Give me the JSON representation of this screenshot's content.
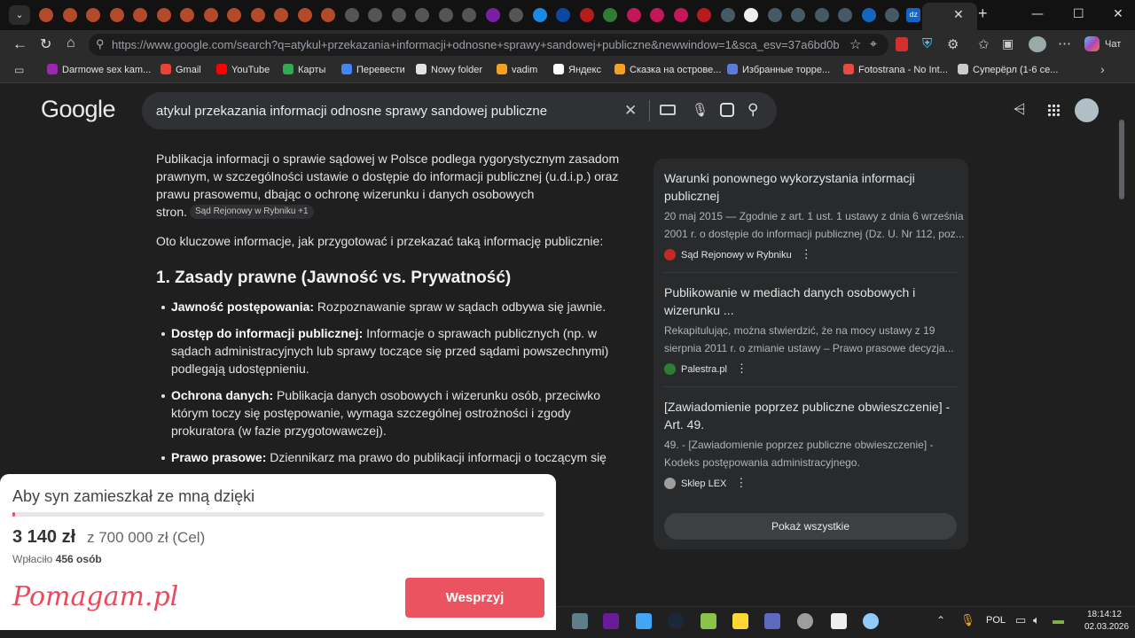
{
  "browser": {
    "url": "https://www.google.com/search?q=atykul+przekazania+informacji+odnosne+sprawy+sandowej+publiczne&newwindow=1&sca_esv=37a6bd0bd2466e07&s...",
    "profile_label": "Чат",
    "tabs_fav_labels": [
      "dz",
      "dz"
    ]
  },
  "bookmarks": [
    {
      "label": "Darmowe sex kam...",
      "color": "#9c27b0"
    },
    {
      "label": "Gmail",
      "color": "#ea4335"
    },
    {
      "label": "YouTube",
      "color": "#ff0000"
    },
    {
      "label": "Карты",
      "color": "#34a853"
    },
    {
      "label": "Перевести",
      "color": "#4285f4"
    },
    {
      "label": "Nowy folder",
      "color": "#e3e3e3"
    },
    {
      "label": "vadim",
      "color": "#f4a023"
    },
    {
      "label": "Яндекс",
      "color": "#ffffff"
    },
    {
      "label": "Сказка на острове...",
      "color": "#f4a023"
    },
    {
      "label": "Избранные торре...",
      "color": "#5b7bd5"
    },
    {
      "label": "Fotostrana - No Int...",
      "color": "#e94a3f"
    },
    {
      "label": "Суперёрл (1-6 се...",
      "color": "#cccccc"
    }
  ],
  "google": {
    "logo": "Google",
    "query": "atykul przekazania informacji odnosne sprawy sandowej publiczne"
  },
  "answer": {
    "intro_lines": [
      "Publikacja informacji o sprawie sądowej w Polsce podlega rygorystycznym zasadom",
      "prawnym, w szczególności ustawie o dostępie do informacji publicznej (u.d.i.p.) oraz",
      "prawu prasowemu, dbając o ochronę wizerunku i danych osobowych",
      "stron."
    ],
    "intro_chip": "Sąd Rejonowy w Rybniku +1",
    "lead": "Oto kluczowe informacje, jak przygotować i przekazać taką informację publicznie:",
    "heading": "1. Zasady prawne (Jawność vs. Prywatność)",
    "bullets": [
      {
        "bold": "Jawność postępowania:",
        "lines": [
          " Rozpoznawanie spraw w sądach odbywa się jawnie."
        ]
      },
      {
        "bold": "Dostęp do informacji publicznej:",
        "lines": [
          " Informacje o sprawach publicznych (np. w",
          "sądach administracyjnych lub sprawy toczące się przed sądami powszechnymi)",
          "podlegają udostępnieniu."
        ]
      },
      {
        "bold": "Ochrona danych:",
        "lines": [
          " Publikacja danych osobowych i wizerunku osób, przeciwko",
          "którym toczy się postępowanie, wymaga szczególnej ostrożności i zgody",
          "prokuratora (w fazie przygotowawczej)."
        ]
      },
      {
        "bold": "Prawo prasowe:",
        "lines": [
          " Dziennikarz ma prawo do publikacji informacji o toczącym się"
        ]
      }
    ]
  },
  "sources": [
    {
      "title": [
        "Warunki ponownego wykorzystania informacji",
        "publicznej"
      ],
      "desc": [
        "20 maj 2015 — Zgodnie z art. 1 ust. 1 ustawy z dnia 6 września",
        "2001 r. o dostępie do informacji publicznej (Dz. U. Nr 112, poz..."
      ],
      "site": "Sąd Rejonowy w Rybniku",
      "color": "#c62828"
    },
    {
      "title": [
        "Publikowanie w mediach danych osobowych i",
        "wizerunku ..."
      ],
      "desc": [
        "Rekapitulując, można stwierdzić, że na mocy ustawy z 19",
        "sierpnia 2011 r. o zmianie ustawy – Prawo prasowe decyzja..."
      ],
      "site": "Palestra.pl",
      "color": "#2e7d32"
    },
    {
      "title": [
        "[Zawiadomienie poprzez publiczne obwieszczenie] -",
        "Art. 49."
      ],
      "desc": [
        "49. - [Zawiadomienie poprzez publiczne obwieszczenie] -",
        "Kodeks postępowania administracyjnego."
      ],
      "site": "Sklep LEX",
      "color": "#9e9e9e"
    }
  ],
  "show_all": "Pokaż wszystkie",
  "ad": {
    "title": "Aby syn zamieszkał ze mną dzięki",
    "raised": "3 140 zł",
    "goal": "z 700 000 zł (Cel)",
    "donors_prefix": "Wpłaciło",
    "donors_count": "456 osób",
    "logo": "Pomagam.pl",
    "button": "Wesprzyj",
    "progress_fraction": 0.0045
  },
  "taskbar": {
    "lang": "POL",
    "time": "18:14:12",
    "date": "02.03.2026"
  }
}
